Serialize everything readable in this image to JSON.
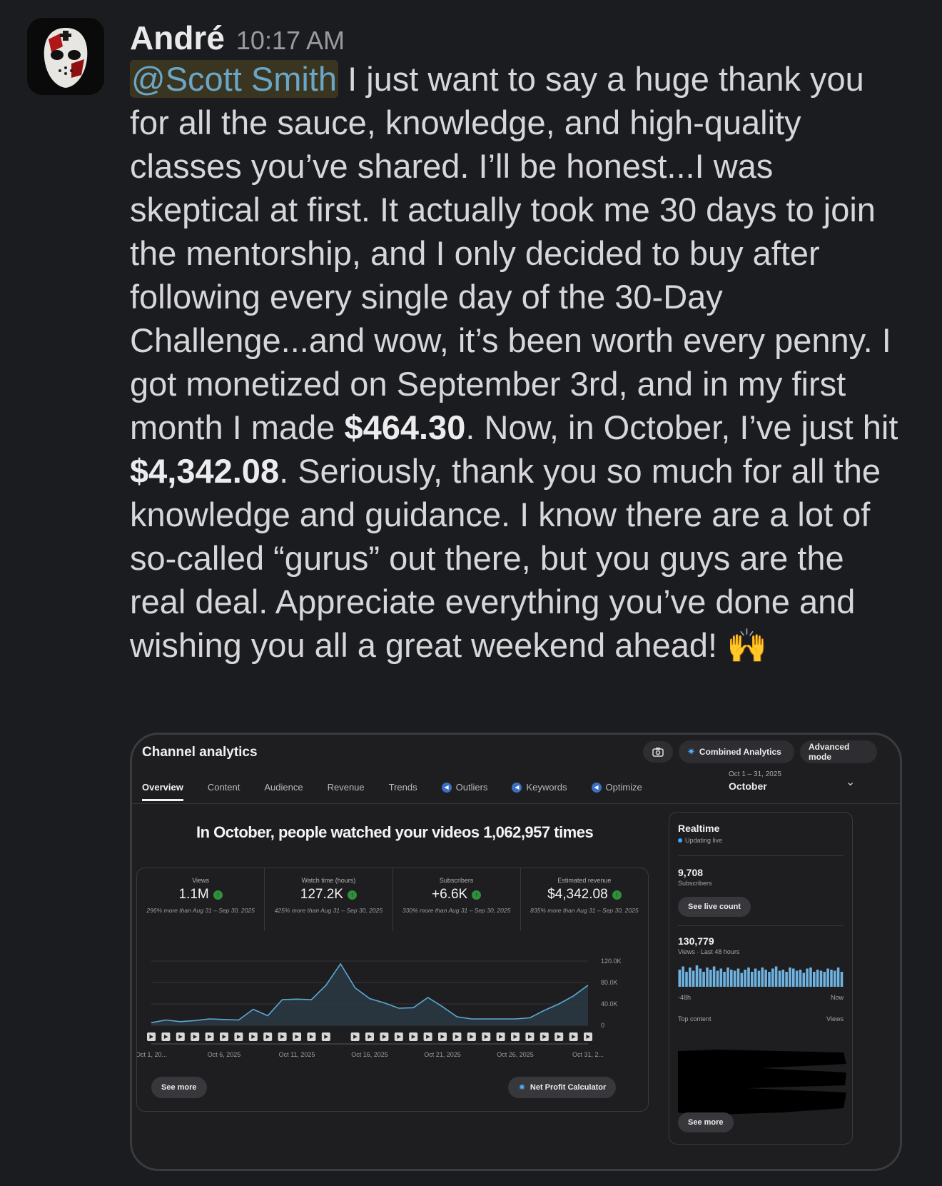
{
  "message": {
    "author": "André",
    "time": "10:17 AM",
    "mention": "@Scott Smith",
    "text_1": " I just want to say a huge thank you for all the sauce, knowledge, and high-quality classes you’ve shared. I’ll be honest...I was skeptical at first. It actually took me 30 days to join the mentorship, and I only decided to buy after following every single day of the 30-Day Challenge...and wow, it’s been worth every penny. I got monetized on September 3rd, and in my first month I made ",
    "amount_1": "$464.30",
    "text_2": ". Now, in October, I’ve just hit ",
    "amount_2": "$4,342.08",
    "text_3": ". Seriously, thank you so much for all the knowledge and guidance. I know there are a lot of so-called “gurus” out there, but you guys are the real deal. Appreciate everything you’ve done and wishing you all a great weekend ahead! ",
    "emoji": "🙌"
  },
  "analytics": {
    "title": "Channel analytics",
    "combined_label": "Combined Analytics",
    "advanced_label": "Advanced mode",
    "tabs": [
      {
        "label": "Overview",
        "active": true
      },
      {
        "label": "Content"
      },
      {
        "label": "Audience"
      },
      {
        "label": "Revenue"
      },
      {
        "label": "Trends"
      },
      {
        "label": "Outliers",
        "icon": "extension-icon"
      },
      {
        "label": "Keywords",
        "icon": "extension-icon"
      },
      {
        "label": "Optimize",
        "icon": "extension-icon"
      }
    ],
    "date_range": "Oct 1 – 31, 2025",
    "date_label": "October",
    "headline": "In October, people watched your videos 1,062,957 times",
    "metrics": [
      {
        "label": "Views",
        "value": "1.1M",
        "delta": "296% more than Aug 31 – Sep 30, 2025"
      },
      {
        "label": "Watch time (hours)",
        "value": "127.2K",
        "delta": "425% more than Aug 31 – Sep 30, 2025"
      },
      {
        "label": "Subscribers",
        "value": "+6.6K",
        "delta": "330% more than Aug 31 – Sep 30, 2025"
      },
      {
        "label": "Estimated revenue",
        "value": "$4,342.08",
        "delta": "835% more than Aug 31 – Sep 30, 2025"
      }
    ],
    "see_more": "See more",
    "net_profit": "Net Profit Calculator",
    "realtime": {
      "title": "Realtime",
      "live": "Updating live",
      "subs_value": "9,708",
      "subs_label": "Subscribers",
      "see_live": "See live count",
      "views_value": "130,779",
      "views_label": "Views · Last 48 hours",
      "axis_left": "-48h",
      "axis_right": "Now",
      "top_content": "Top content",
      "views_col": "Views",
      "see_more": "See more"
    }
  },
  "chart_data": {
    "type": "area",
    "x": [
      "Oct 1",
      "Oct 2",
      "Oct 3",
      "Oct 4",
      "Oct 5",
      "Oct 6",
      "Oct 7",
      "Oct 8",
      "Oct 9",
      "Oct 10",
      "Oct 11",
      "Oct 12",
      "Oct 13",
      "Oct 14",
      "Oct 15",
      "Oct 16",
      "Oct 17",
      "Oct 18",
      "Oct 19",
      "Oct 20",
      "Oct 21",
      "Oct 22",
      "Oct 23",
      "Oct 24",
      "Oct 25",
      "Oct 26",
      "Oct 27",
      "Oct 28",
      "Oct 29",
      "Oct 30",
      "Oct 31"
    ],
    "values": [
      5000,
      10000,
      7000,
      9000,
      12000,
      11000,
      10000,
      30000,
      18000,
      48000,
      49000,
      48000,
      75000,
      115000,
      70000,
      50000,
      42000,
      32000,
      33000,
      52000,
      35000,
      16000,
      12000,
      12000,
      12000,
      12000,
      14000,
      28000,
      40000,
      55000,
      75000
    ],
    "x_tick_labels": [
      "Oct 1, 20...",
      "Oct 6, 2025",
      "Oct 11, 2025",
      "Oct 16, 2025",
      "Oct 21, 2025",
      "Oct 26, 2025",
      "Oct 31, 2..."
    ],
    "y_tick_labels": [
      "120.0K",
      "80.0K",
      "40.0K",
      "0"
    ],
    "ylim": [
      0,
      120000
    ],
    "grid": true
  },
  "realtime_bars": [
    0.8,
    0.95,
    0.7,
    0.9,
    0.75,
    1,
    0.85,
    0.7,
    0.9,
    0.8,
    0.95,
    0.75,
    0.85,
    0.7,
    0.9,
    0.8,
    0.75,
    0.85,
    0.65,
    0.8,
    0.9,
    0.7,
    0.85,
    0.75,
    0.9,
    0.8,
    0.7,
    0.85,
    0.95,
    0.75,
    0.8,
    0.7,
    0.9,
    0.85,
    0.75,
    0.8,
    0.65,
    0.85,
    0.9,
    0.7,
    0.8,
    0.75,
    0.7,
    0.85,
    0.8,
    0.75,
    0.9,
    0.7
  ]
}
